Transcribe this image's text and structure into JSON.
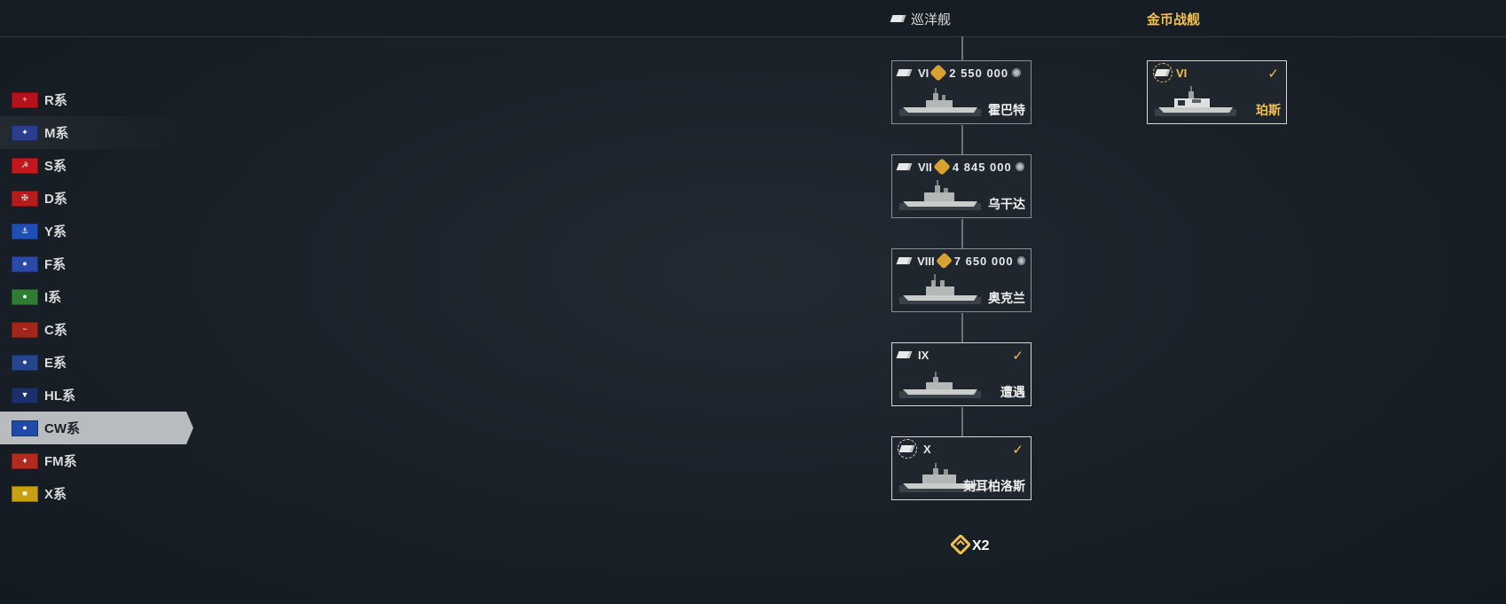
{
  "header": {
    "cruiser_label": "巡洋舰",
    "gold_label": "金币战舰"
  },
  "sidebar": {
    "items": [
      {
        "label": "R系",
        "flag_color": "#b5121b",
        "flag_glyph": "+"
      },
      {
        "label": "M系",
        "flag_color": "#2a3d8f",
        "flag_glyph": "✦"
      },
      {
        "label": "S系",
        "flag_color": "#c4161c",
        "flag_glyph": "☭"
      },
      {
        "label": "D系",
        "flag_color": "#b71c1c",
        "flag_glyph": "✠"
      },
      {
        "label": "Y系",
        "flag_color": "#1f4fb4",
        "flag_glyph": "⚓"
      },
      {
        "label": "F系",
        "flag_color": "#2b4aa8",
        "flag_glyph": "●"
      },
      {
        "label": "I系",
        "flag_color": "#2e7d32",
        "flag_glyph": "●"
      },
      {
        "label": "C系",
        "flag_color": "#a3261b",
        "flag_glyph": "~"
      },
      {
        "label": "E系",
        "flag_color": "#25468c",
        "flag_glyph": "●"
      },
      {
        "label": "HL系",
        "flag_color": "#1b2f6b",
        "flag_glyph": "▼"
      },
      {
        "label": "CW系",
        "flag_color": "#2149a6",
        "flag_glyph": "●"
      },
      {
        "label": "FM系",
        "flag_color": "#b52a1f",
        "flag_glyph": "♦"
      },
      {
        "label": "X系",
        "flag_color": "#c8a012",
        "flag_glyph": "■"
      }
    ],
    "active_label": "CW系"
  },
  "tree": {
    "ships": [
      {
        "tier": "VI",
        "cost": "2  550  000",
        "name": "霍巴特",
        "researched": false
      },
      {
        "tier": "VII",
        "cost": "4  845  000",
        "name": "乌干达",
        "researched": false
      },
      {
        "tier": "VIII",
        "cost": "7  650  000",
        "name": "奥克兰",
        "researched": false
      },
      {
        "tier": "IX",
        "cost": "",
        "name": "遭遇",
        "researched": true
      },
      {
        "tier": "X",
        "cost": "",
        "name": "刻耳柏洛斯",
        "researched": true
      }
    ],
    "gold_ship": {
      "tier": "VI",
      "name": "珀斯",
      "researched": true
    },
    "bonus_text": "X2"
  },
  "colors": {
    "accent_gold": "#f2c14e",
    "active_tab": "#b9bcbf"
  }
}
